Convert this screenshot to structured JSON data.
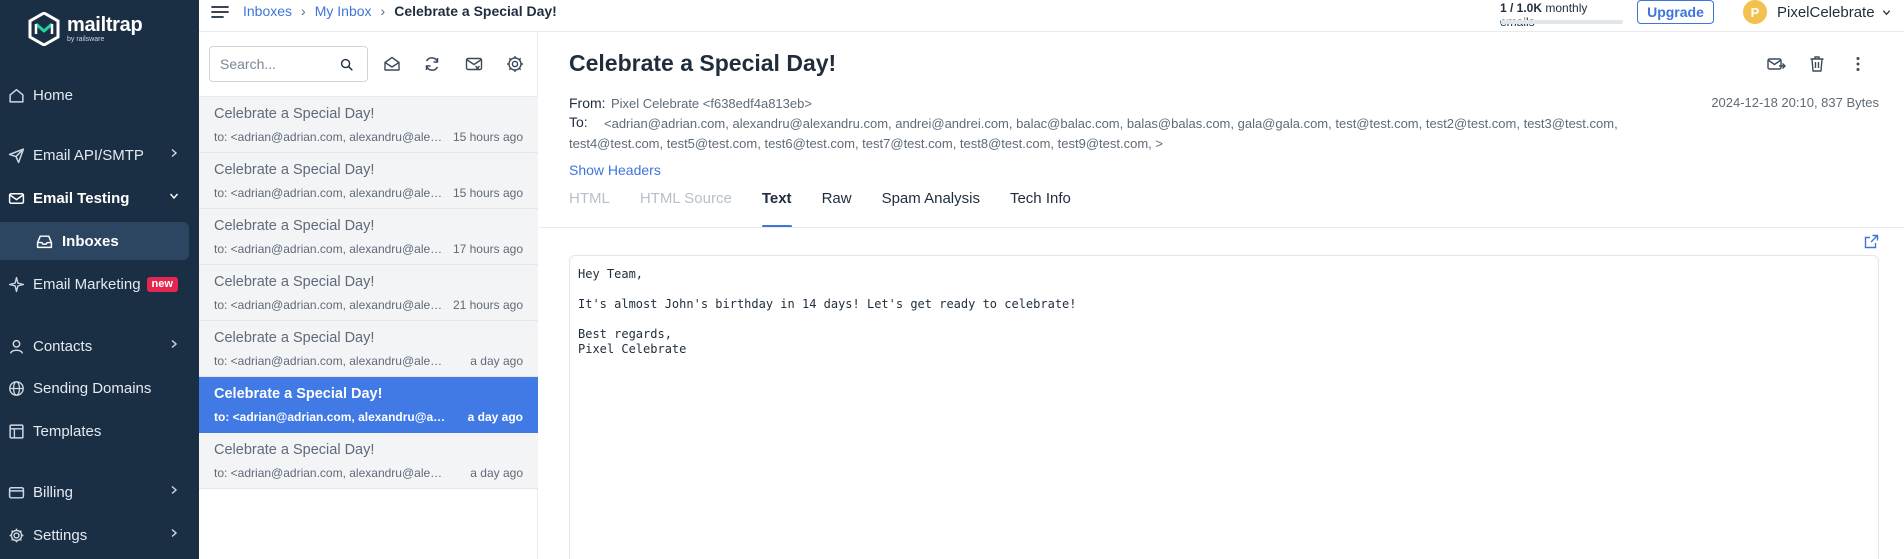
{
  "brand": {
    "name": "mailtrap",
    "byline": "by railsware",
    "color": "#1b2f44",
    "accent": "#3f74d9"
  },
  "sidebar": {
    "items": [
      {
        "label": "Home",
        "icon": "home-icon"
      },
      {
        "label": "Email API/SMTP",
        "icon": "send-icon"
      },
      {
        "label": "Email Testing",
        "icon": "email-testing-icon"
      },
      {
        "label": "Inboxes",
        "icon": "inbox-icon"
      },
      {
        "label": "Email Marketing",
        "icon": "sparkle-icon",
        "badge": "new"
      },
      {
        "label": "Contacts",
        "icon": "user-icon"
      },
      {
        "label": "Sending Domains",
        "icon": "globe-icon"
      },
      {
        "label": "Templates",
        "icon": "template-icon"
      },
      {
        "label": "Billing",
        "icon": "billing-icon"
      },
      {
        "label": "Settings",
        "icon": "gear-icon"
      }
    ]
  },
  "header": {
    "breadcrumb": [
      "Inboxes",
      "My Inbox",
      "Celebrate a Special Day!"
    ],
    "usage": {
      "count": "1 / 1.0K",
      "label": "monthly emails",
      "fraction": 0.001
    },
    "upgrade_label": "Upgrade",
    "user": {
      "initial": "P",
      "name": "PixelCelebrate"
    }
  },
  "list": {
    "search_placeholder": "Search...",
    "messages": [
      {
        "subject": "Celebrate a Special Day!",
        "to": "to: <adrian@adrian.com, alexandru@alexandru.com",
        "time": "15 hours ago"
      },
      {
        "subject": "Celebrate a Special Day!",
        "to": "to: <adrian@adrian.com, alexandru@alexandru.com",
        "time": "15 hours ago"
      },
      {
        "subject": "Celebrate a Special Day!",
        "to": "to: <adrian@adrian.com, alexandru@alexandru.com",
        "time": "17 hours ago"
      },
      {
        "subject": "Celebrate a Special Day!",
        "to": "to: <adrian@adrian.com, alexandru@alexandru.com",
        "time": "21 hours ago"
      },
      {
        "subject": "Celebrate a Special Day!",
        "to": "to: <adrian@adrian.com, alexandru@alexandru.com",
        "time": "a day ago"
      },
      {
        "subject": "Celebrate a Special Day!",
        "to": "to: <adrian@adrian.com, alexandru@alexandru.com",
        "time": "a day ago",
        "selected": true
      },
      {
        "subject": "Celebrate a Special Day!",
        "to": "to: <adrian@adrian.com, alexandru@alexandru.com",
        "time": "a day ago"
      }
    ]
  },
  "message": {
    "title": "Celebrate a Special Day!",
    "from_label": "From:",
    "from": "Pixel Celebrate <f638edf4a813eb>",
    "to_label": "To:",
    "to_line1": "<adrian@adrian.com, alexandru@alexandru.com, andrei@andrei.com, balac@balac.com, balas@balas.com, gala@gala.com, test@test.com, test2@test.com, test3@test.com,",
    "to_line2": "test4@test.com, test5@test.com, test6@test.com, test7@test.com, test8@test.com, test9@test.com, >",
    "date": "2024-12-18 20:10, 837 Bytes",
    "show_headers": "Show Headers",
    "tabs": [
      {
        "label": "HTML",
        "state": "disabled"
      },
      {
        "label": "HTML Source",
        "state": "disabled"
      },
      {
        "label": "Text",
        "state": "active"
      },
      {
        "label": "Raw",
        "state": "normal"
      },
      {
        "label": "Spam Analysis",
        "state": "normal"
      },
      {
        "label": "Tech Info",
        "state": "normal"
      }
    ],
    "body": "Hey Team,\n\nIt's almost John's birthday in 14 days! Let's get ready to celebrate!\n\nBest regards,\nPixel Celebrate"
  }
}
